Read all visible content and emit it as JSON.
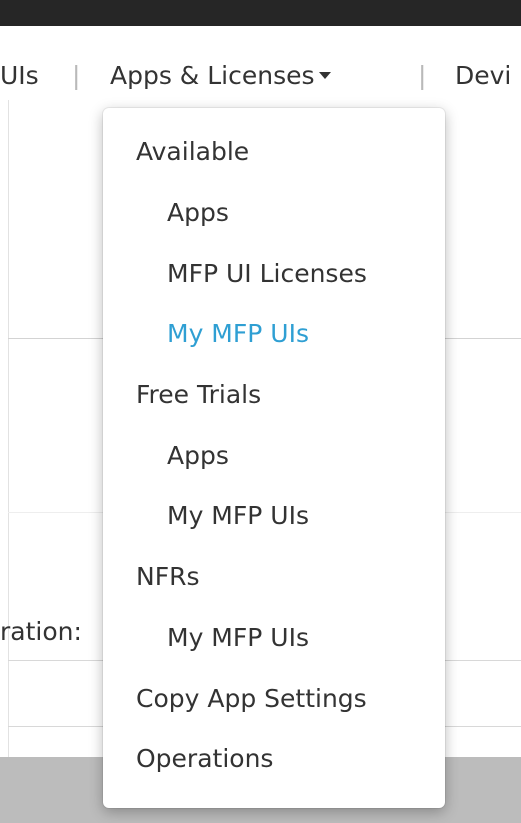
{
  "nav": {
    "items": [
      {
        "label": "UIs"
      },
      {
        "label": "Apps & Licenses"
      },
      {
        "label": "Devi"
      }
    ]
  },
  "background": {
    "field_label": "ration:"
  },
  "menu": {
    "items": [
      {
        "label": "Available"
      },
      {
        "label": "Apps"
      },
      {
        "label": "MFP UI Licenses"
      },
      {
        "label": "My MFP UIs"
      },
      {
        "label": "Free Trials"
      },
      {
        "label": "Apps"
      },
      {
        "label": "My MFP UIs"
      },
      {
        "label": "NFRs"
      },
      {
        "label": "My MFP UIs"
      },
      {
        "label": "Copy App Settings"
      },
      {
        "label": "Operations"
      }
    ],
    "active_color": "#2f9fd3",
    "text_color": "#333333"
  }
}
